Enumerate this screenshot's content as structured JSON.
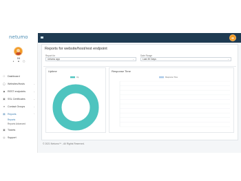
{
  "app": {
    "logo_text": "netumo",
    "user_name": "Bill",
    "user_icons": [
      "user-icon",
      "lock-icon",
      "power-icon"
    ]
  },
  "sidebar": {
    "items": [
      {
        "label": "Dashboard",
        "icon": "dashboard-icon"
      },
      {
        "label": "Websites/Hosts",
        "icon": "globe-icon"
      },
      {
        "label": "REST endpoints",
        "icon": "api-icon"
      },
      {
        "label": "SSL Certificates",
        "icon": "certificate-icon"
      },
      {
        "label": "Contact Groups",
        "icon": "contacts-icon"
      },
      {
        "label": "Reports",
        "icon": "reports-icon"
      }
    ],
    "sub_items": [
      {
        "label": "Reports"
      },
      {
        "label": "Reports Advanced"
      }
    ],
    "bottom_items": [
      {
        "label": "Tickets",
        "icon": "ticket-icon"
      },
      {
        "label": "Support",
        "icon": "support-icon"
      }
    ]
  },
  "header": {
    "menu_icon": "hamburger-icon"
  },
  "main": {
    "page_title": "Reports for website/host/rest endpoint",
    "report_for_label": "Report for",
    "report_for_value": "netumo app",
    "date_range_label": "Date Range",
    "date_range_value": "Last 30 Days",
    "uptime_title": "Uptime",
    "response_title": "Response Time"
  },
  "footer": {
    "text": "© 2021 Netumo™ - All Rights Reserved."
  },
  "colors": {
    "topbar": "#1f3b52",
    "accent": "#4ec4bf",
    "response_legend": "#a8c8e8",
    "link": "#3a7cb0"
  },
  "chart_data": [
    {
      "type": "pie",
      "title": "Uptime",
      "legend": [
        "Up"
      ],
      "values": [
        100
      ],
      "colors": [
        "#4ec4bf"
      ]
    },
    {
      "type": "line",
      "title": "Response Time",
      "legend": [
        "Response Time"
      ],
      "y_tick_labels": [
        "",
        "",
        "",
        "",
        "",
        "",
        "",
        "",
        "",
        "",
        ""
      ],
      "x_tick_labels": []
    }
  ]
}
